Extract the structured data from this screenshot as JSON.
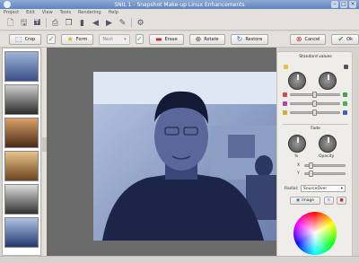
{
  "window": {
    "title": "SNIL 1 - Snapshot Make-up Linux Enhancements"
  },
  "menu": {
    "items": [
      "Project",
      "Edit",
      "View",
      "Tools",
      "Rendering",
      "Help"
    ]
  },
  "actions": {
    "crop": "Crop",
    "form": "Form",
    "select_value": "Next",
    "erase": "Erase",
    "rotate": "Rotate",
    "restore": "Restore",
    "cancel": "Cancel",
    "ok": "Ok"
  },
  "panel": {
    "standard_values": "Standard values",
    "fade": "Fade",
    "knob_left": "%",
    "knob_right": "Opacity",
    "slider_x": "X",
    "slider_y": "Y",
    "radial_label": "Radial:",
    "radial_value": "SourceOver",
    "image_button": "Image"
  },
  "colors": {
    "accent": "#5f84c0",
    "red": "#c03030",
    "green": "#3a9a3a"
  }
}
